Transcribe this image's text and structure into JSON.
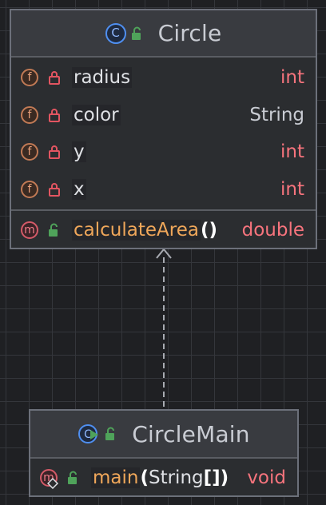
{
  "classes": {
    "circle": {
      "name": "Circle",
      "fields": [
        {
          "name": "radius",
          "type": "int"
        },
        {
          "name": "color",
          "type": "String"
        },
        {
          "name": "y",
          "type": "int"
        },
        {
          "name": "x",
          "type": "int"
        }
      ],
      "methods": [
        {
          "name": "calculateArea",
          "params": "()",
          "return_type": "double"
        }
      ]
    },
    "circle_main": {
      "name": "CircleMain",
      "methods": [
        {
          "name": "main",
          "params_open": "(",
          "param_type": "String",
          "params_close": "[])",
          "return_type": "void"
        }
      ]
    }
  },
  "badges": {
    "field": "f",
    "method": "m",
    "class": "C"
  },
  "colors": {
    "background": "#1f2023",
    "class_header": "#393b40",
    "type_int": "#f7747d",
    "method_name": "#f0a75a",
    "class_icon": "#4f8ff0"
  },
  "icons": {
    "class": "class-icon",
    "runnable_class": "runnable-class-icon",
    "field": "field-icon",
    "method": "method-icon",
    "private": "lock-closed-icon",
    "public": "lock-open-icon",
    "relationship": "inheritance-arrow-icon"
  }
}
